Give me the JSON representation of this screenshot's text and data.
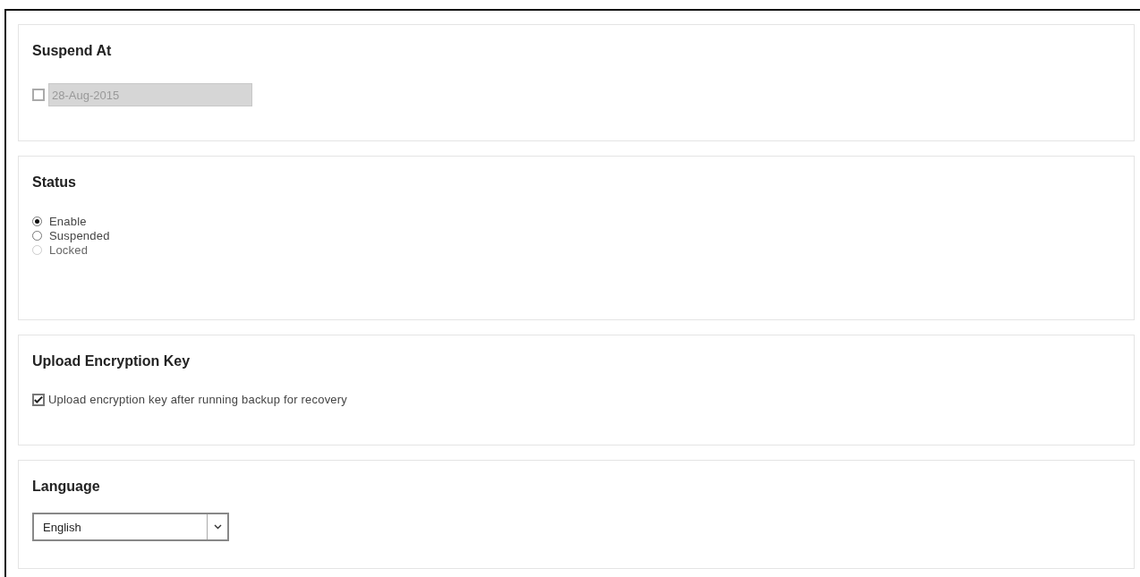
{
  "sections": [
    {
      "kind": "date",
      "title": "Suspend At",
      "checked": false,
      "value": "28-Aug-2015",
      "disabled": true
    },
    {
      "kind": "radio",
      "title": "Status",
      "options": [
        {
          "label": "Enable",
          "selected": true,
          "disabled": false
        },
        {
          "label": "Suspended",
          "selected": false,
          "disabled": false
        },
        {
          "label": "Locked",
          "selected": false,
          "disabled": true
        }
      ]
    },
    {
      "kind": "checkbox",
      "title": "Upload Encryption Key",
      "label": "Upload encryption key after running backup for recovery",
      "checked": true
    },
    {
      "kind": "select",
      "title": "Language",
      "value": "English"
    }
  ]
}
